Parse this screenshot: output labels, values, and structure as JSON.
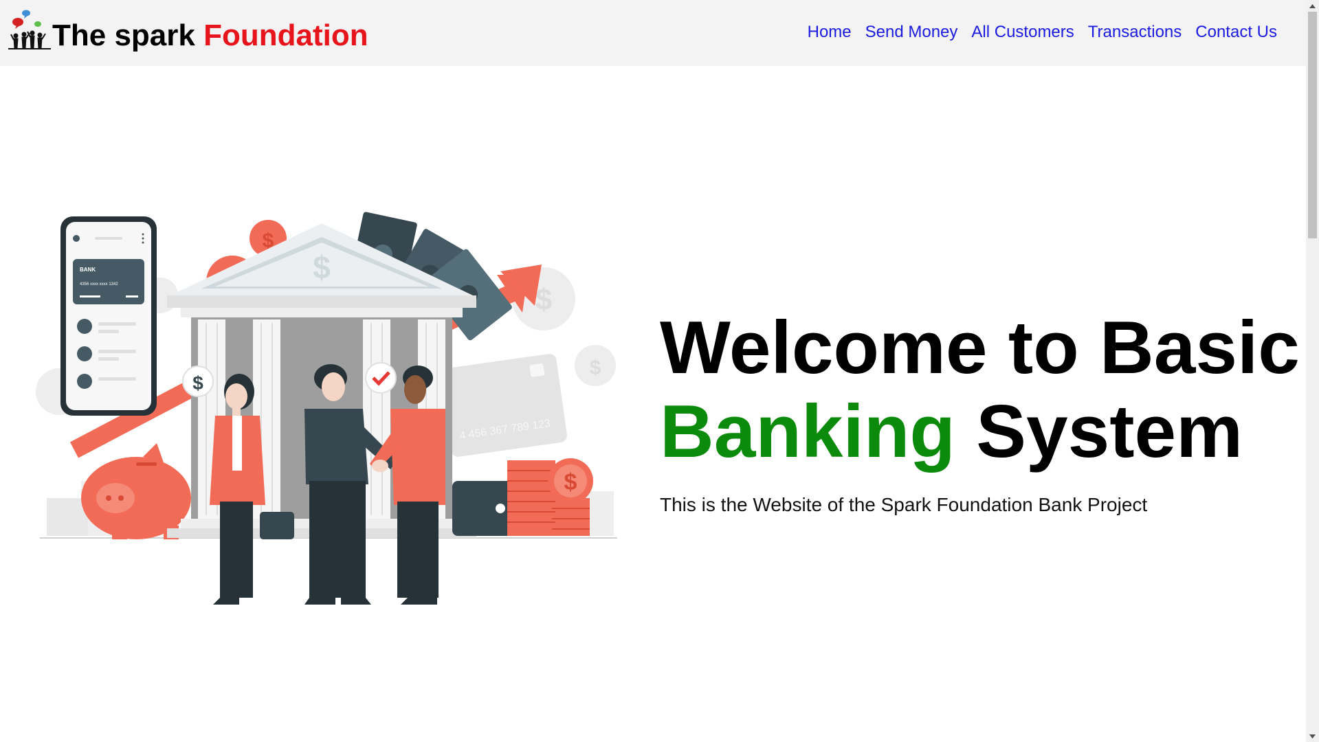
{
  "navbar": {
    "brand": {
      "text_part1": "The spark ",
      "text_part2": "Foundation",
      "logo_icon": "people-speech-bubbles-logo"
    },
    "links": [
      {
        "label": "Home"
      },
      {
        "label": "Send Money"
      },
      {
        "label": "All Customers"
      },
      {
        "label": "Transactions"
      },
      {
        "label": "Contact Us"
      }
    ]
  },
  "hero": {
    "title_line1": "Welcome to Basic",
    "title_highlight": "Banking",
    "title_rest": " System",
    "subtitle": "This is the Website of the Spark Foundation Bank Project",
    "illustration": {
      "icon": "banking-handshake-illustration",
      "card_label": "BANK",
      "card_number_short": "4356  xxxx  xxxx  1342",
      "card_number_long": "4 456 367 789 123"
    }
  },
  "colors": {
    "nav_background": "#f3f3f3",
    "nav_link": "#1a1ae0",
    "brand_red": "#e8141c",
    "highlight_green": "#0b8a0b",
    "illustration_coral": "#f26b56",
    "illustration_dark": "#37474f"
  }
}
